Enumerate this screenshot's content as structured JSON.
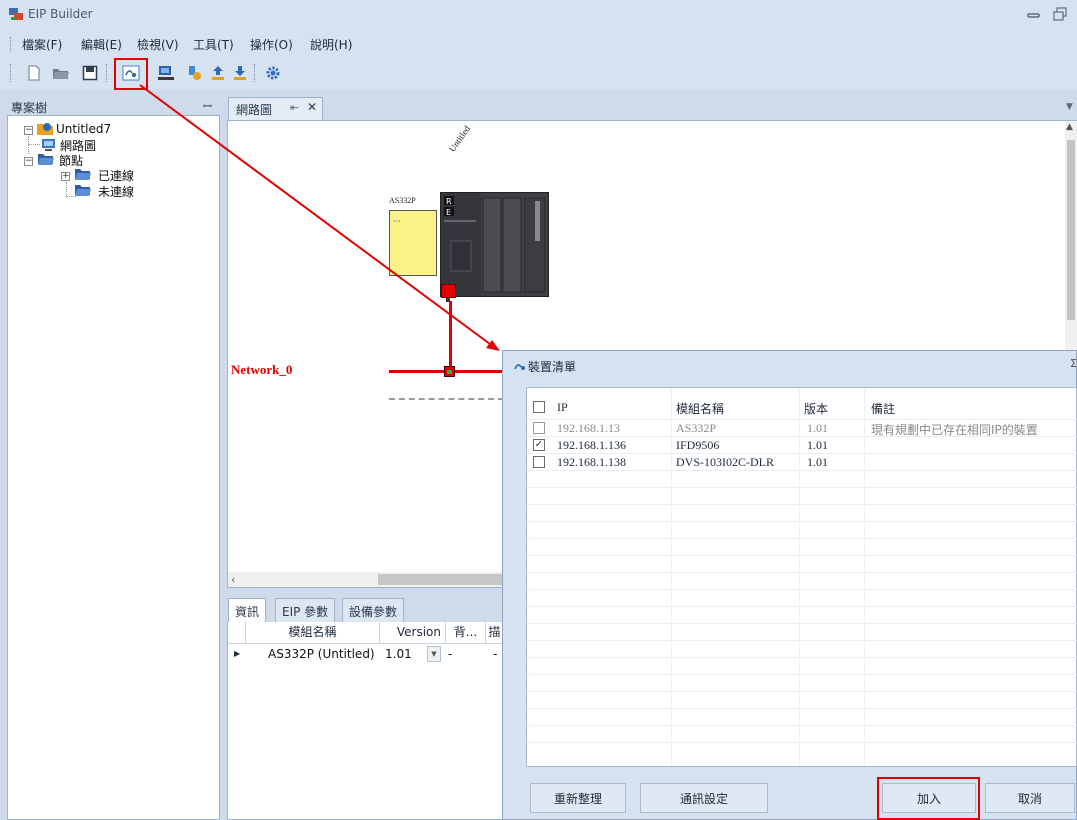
{
  "window": {
    "title": "EIP Builder"
  },
  "menu": [
    "檔案(F)",
    "編輯(E)",
    "檢視(V)",
    "工具(T)",
    "操作(O)",
    "說明(H)"
  ],
  "toolbar": {
    "icons": [
      "new-file-icon",
      "open-folder-icon",
      "save-icon",
      "scan-network-icon",
      "device-icon",
      "node-icon",
      "upload-icon",
      "download-icon",
      "settings-gear-icon"
    ],
    "highlight_color": "#e00000"
  },
  "project_tree": {
    "title": "專案樹",
    "root": "Untitled7",
    "nodes": {
      "network_diagram": "網路圖",
      "nodes_folder": "節點",
      "connected": "已連線",
      "unconnected": "未連線"
    }
  },
  "document_tab": {
    "label": "網路圖"
  },
  "diagram": {
    "plc_name": "Untitled",
    "module_label": "AS332P",
    "network_label": "Network_0",
    "network_color": "#e00000"
  },
  "info_panel": {
    "tabs": [
      "資訊",
      "EIP 參數",
      "設備參數"
    ],
    "columns": [
      "模組名稱",
      "Version",
      "背...",
      "描"
    ],
    "row": {
      "name": "AS332P (Untitled)",
      "version": "1.01",
      "c3": "-",
      "c4": "-"
    }
  },
  "device_dialog": {
    "title": "裝置清單",
    "columns": {
      "ip": "IP",
      "module": "模組名稱",
      "version": "版本",
      "note": "備註"
    },
    "rows": [
      {
        "ip": "192.168.1.13",
        "module": "AS332P",
        "version": "1.01",
        "note": "現有規劃中已存在相同IP的裝置",
        "checked": false,
        "disabled": true
      },
      {
        "ip": "192.168.1.136",
        "module": "IFD9506",
        "version": "1.01",
        "note": "",
        "checked": true,
        "disabled": false
      },
      {
        "ip": "192.168.1.138",
        "module": "DVS-103I02C-DLR",
        "version": "1.01",
        "note": "",
        "checked": false,
        "disabled": false
      }
    ],
    "buttons": {
      "refresh": "重新整理",
      "comm_settings": "通訊設定",
      "add": "加入",
      "cancel": "取消"
    }
  }
}
